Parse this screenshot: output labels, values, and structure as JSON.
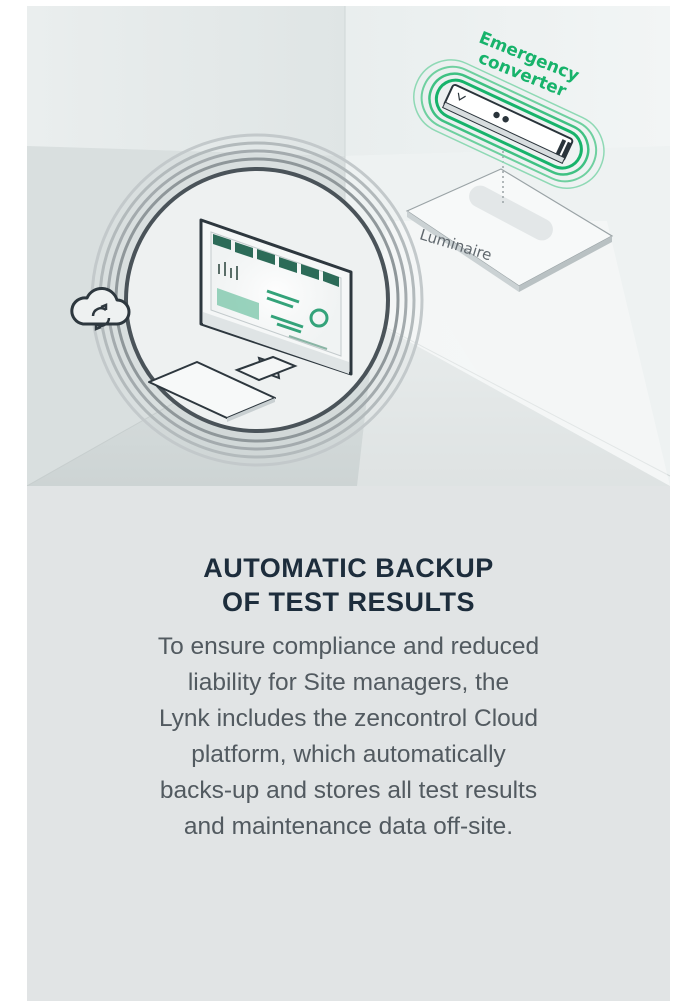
{
  "illustration": {
    "converter_label_line1": "Emergency",
    "converter_label_line2": "converter",
    "luminaire_label": "Luminaire"
  },
  "content": {
    "title_line1": "AUTOMATIC BACKUP",
    "title_line2": "OF TEST RESULTS",
    "body_line1": "To ensure compliance and reduced",
    "body_line2": "liability for Site managers, the",
    "body_line3": "Lynk includes the zencontrol Cloud",
    "body_line4": "platform, which automatically",
    "body_line5": "backs-up and stores all test results",
    "body_line6": "and maintenance data off-site."
  },
  "colors": {
    "card_background": "#e1e4e5",
    "accent_green": "#17b36b",
    "title_color": "#1d2d3c",
    "body_color": "#525a60"
  }
}
